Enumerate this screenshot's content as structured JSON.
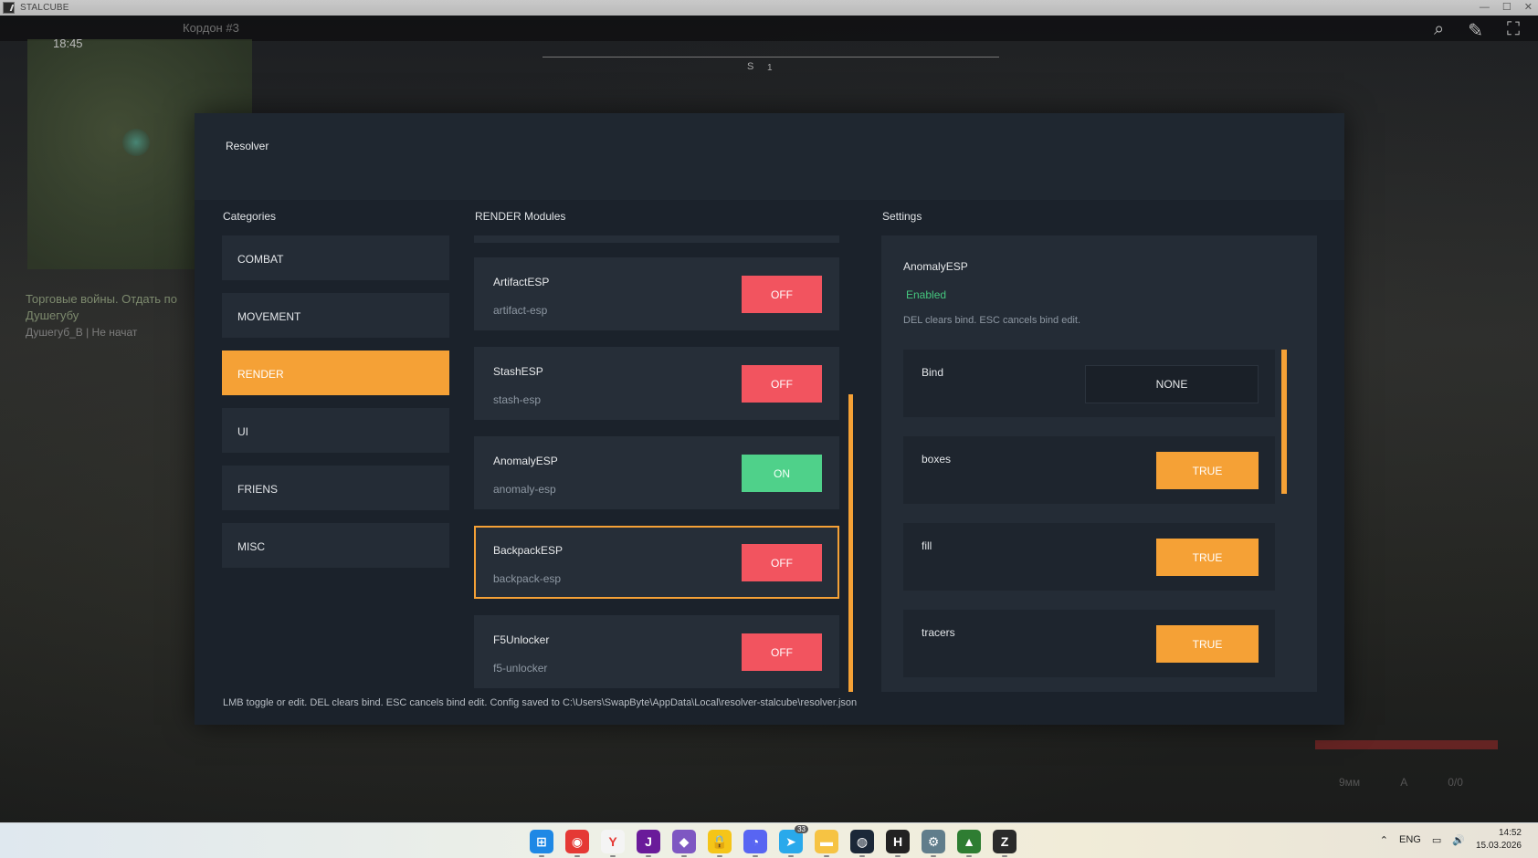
{
  "window": {
    "title": "STALCUBE"
  },
  "hud": {
    "time": "18:45",
    "location": "Кордон #3",
    "compass_dir": "S",
    "compass_num": "1",
    "quest_title_1": "Торговые войны. Отдать по",
    "quest_title_2": "Душегубу",
    "quest_sub": "Душегуб_В | Не начат",
    "ammo_mode": "9мм",
    "ammo_fire": "A",
    "ammo_count": "0/0"
  },
  "panel": {
    "title": "Resolver",
    "categories_label": "Categories",
    "modules_label": "RENDER Modules",
    "settings_label": "Settings",
    "footer_hint": "LMB toggle or edit. DEL clears bind. ESC cancels bind edit. Config saved to C:\\Users\\SwapByte\\AppData\\Local\\resolver-stalcube\\resolver.json"
  },
  "categories": [
    {
      "label": "COMBAT",
      "active": false
    },
    {
      "label": "MOVEMENT",
      "active": false
    },
    {
      "label": "RENDER",
      "active": true
    },
    {
      "label": "UI",
      "active": false
    },
    {
      "label": "FRIENS",
      "active": false
    },
    {
      "label": "MISC",
      "active": false
    }
  ],
  "modules": [
    {
      "name": "ArtifactESP",
      "id": "artifact-esp",
      "state": "OFF"
    },
    {
      "name": "StashESP",
      "id": "stash-esp",
      "state": "OFF"
    },
    {
      "name": "AnomalyESP",
      "id": "anomaly-esp",
      "state": "ON"
    },
    {
      "name": "BackpackESP",
      "id": "backpack-esp",
      "state": "OFF"
    },
    {
      "name": "F5Unlocker",
      "id": "f5-unlocker",
      "state": "OFF"
    }
  ],
  "settings": {
    "module_name": "AnomalyESP",
    "status": "Enabled",
    "hint": "DEL clears bind. ESC cancels bind edit.",
    "bind_label": "Bind",
    "bind_value": "NONE",
    "options": [
      {
        "label": "boxes",
        "value": "TRUE"
      },
      {
        "label": "fill",
        "value": "TRUE"
      },
      {
        "label": "tracers",
        "value": "TRUE"
      }
    ]
  },
  "taskbar": {
    "language": "ENG",
    "time": "14:52",
    "date": "15.03.2026",
    "telegram_badge": "33",
    "apps": [
      {
        "name": "windows-start",
        "glyph": "⊞",
        "color": "#1e88e5"
      },
      {
        "name": "chrome",
        "glyph": "◉",
        "color": "#e53935"
      },
      {
        "name": "yandex-browser",
        "glyph": "Y",
        "color": "#f4f4f4"
      },
      {
        "name": "jetbrains",
        "glyph": "J",
        "color": "#6a1b9a"
      },
      {
        "name": "visual-studio",
        "glyph": "◆",
        "color": "#7e57c2"
      },
      {
        "name": "keepass",
        "glyph": "🔒",
        "color": "#f5c518"
      },
      {
        "name": "discord",
        "glyph": "◔",
        "color": "#5865f2"
      },
      {
        "name": "telegram",
        "glyph": "➤",
        "color": "#29a9eb"
      },
      {
        "name": "file-explorer",
        "glyph": "▬",
        "color": "#f6c343"
      },
      {
        "name": "steam",
        "glyph": "◍",
        "color": "#1b2838"
      },
      {
        "name": "hackmd",
        "glyph": "H",
        "color": "#222222"
      },
      {
        "name": "settings",
        "glyph": "⚙",
        "color": "#607d8b"
      },
      {
        "name": "map-app",
        "glyph": "▲",
        "color": "#2e7d32"
      },
      {
        "name": "stalcube",
        "glyph": "Z",
        "color": "#2a2a2a"
      }
    ]
  },
  "colors": {
    "accent": "#f5a136",
    "off": "#f2545f",
    "on": "#4fd18a",
    "enabled_text": "#45c67e"
  }
}
